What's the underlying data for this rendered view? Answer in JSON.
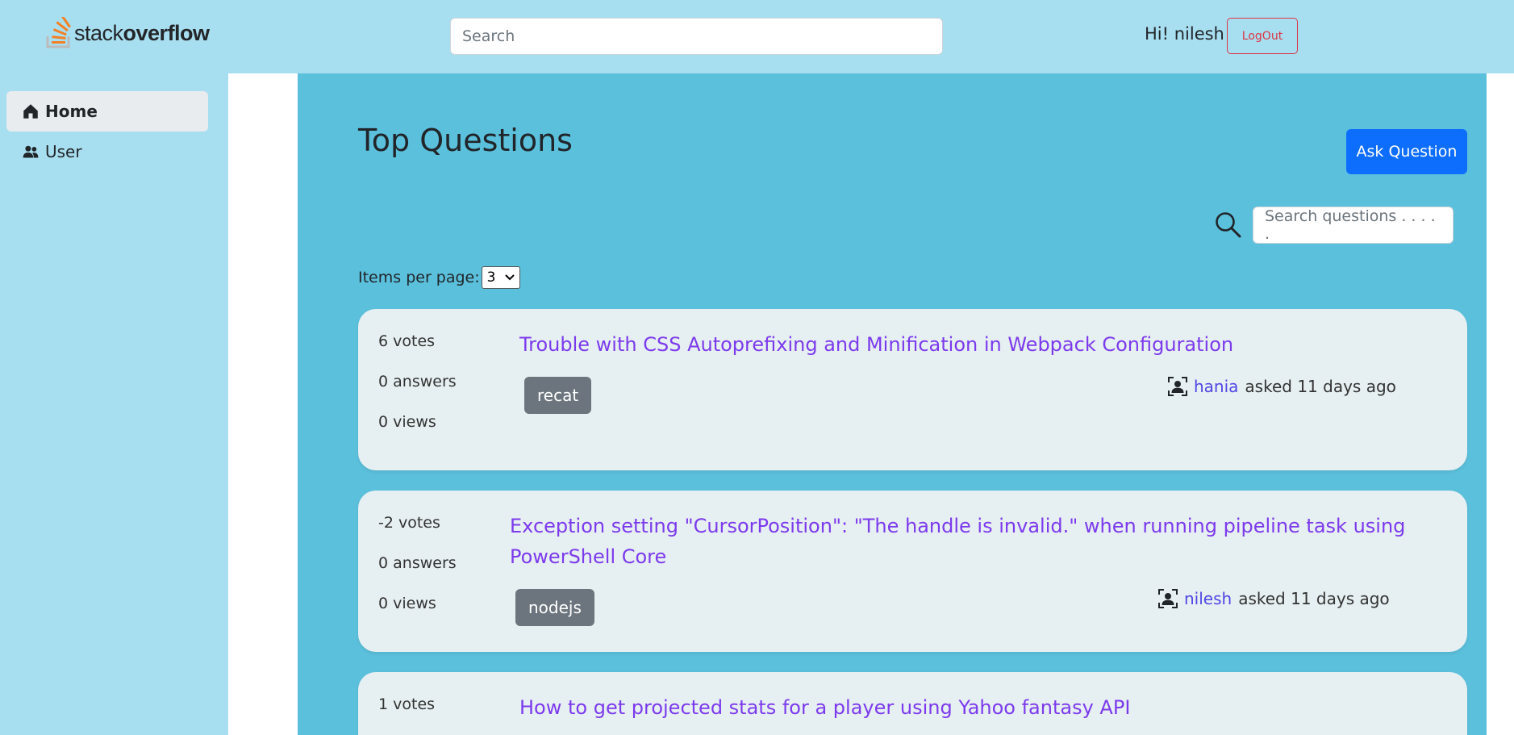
{
  "header": {
    "logo_text_light": "stack",
    "logo_text_bold": "overflow",
    "search_placeholder": "Search",
    "greeting": "Hi! nilesh",
    "logout_label": "LogOut"
  },
  "sidebar": {
    "items": [
      {
        "label": "Home",
        "icon": "home-icon",
        "active": true
      },
      {
        "label": "User",
        "icon": "users-icon",
        "active": false
      }
    ]
  },
  "main": {
    "title": "Top Questions",
    "ask_button": "Ask Question",
    "search_placeholder": "Search questions . . . . .",
    "items_per_page_label": "Items per page:",
    "items_per_page_value": "3",
    "questions": [
      {
        "votes": "6 votes",
        "answers": "0 answers",
        "views": "0 views",
        "title": "Trouble with CSS Autoprefixing and Minification in Webpack Configuration",
        "tag": "recat",
        "user": "hania",
        "asked": "asked 11 days ago"
      },
      {
        "votes": "-2 votes",
        "answers": "0 answers",
        "views": "0 views",
        "title_line1": "Exception setting \"CursorPosition\": \"The handle is invalid.\" when running pipeline task using",
        "title_line2": "PowerShell Core",
        "tag": "nodejs",
        "user": "nilesh",
        "asked": "asked 11 days ago"
      },
      {
        "votes": "1 votes",
        "title": "How to get projected stats for a player using Yahoo fantasy API"
      }
    ]
  },
  "colors": {
    "header_bg": "#a8dff0",
    "main_bg": "#5bc0dc",
    "card_bg": "#e6eff1",
    "ask_button": "#0d6efd",
    "logout": "#dc3545",
    "question_link": "#7c3aed",
    "tag_bg": "#6c757d"
  }
}
